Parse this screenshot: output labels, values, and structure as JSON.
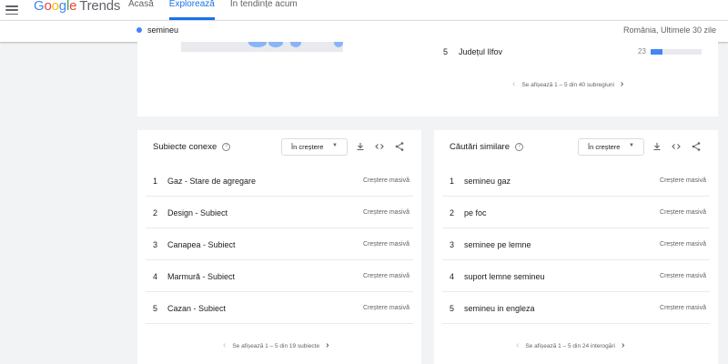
{
  "header": {
    "logo_letters": [
      "G",
      "o",
      "o",
      "g",
      "l",
      "e"
    ],
    "logo_product": "Trends",
    "nav": [
      {
        "label": "Acasă",
        "active": false
      },
      {
        "label": "Explorează",
        "active": true
      },
      {
        "label": "În tendințe acum",
        "active": false
      }
    ]
  },
  "search": {
    "term": "semineu",
    "term_color": "#4285f4",
    "region_time": "România, Ultimele 30 zile"
  },
  "subregions": {
    "visible_row": {
      "rank": "5",
      "name": "Județul Ilfov",
      "value": "23",
      "fraction": 0.23
    },
    "pager_text": "Se afișează 1 – 5 din 40 subregiuni"
  },
  "related_topics": {
    "title": "Subiecte conexe",
    "sort_label": "În creștere",
    "rows": [
      {
        "rank": "1",
        "label": "Gaz - Stare de agregare",
        "status": "Creștere masivă"
      },
      {
        "rank": "2",
        "label": "Design - Subiect",
        "status": "Creștere masivă"
      },
      {
        "rank": "3",
        "label": "Canapea - Subiect",
        "status": "Creștere masivă"
      },
      {
        "rank": "4",
        "label": "Marmură - Subiect",
        "status": "Creștere masivă"
      },
      {
        "rank": "5",
        "label": "Cazan - Subiect",
        "status": "Creștere masivă"
      }
    ],
    "pager_text": "Se afișează 1 – 5 din 19 subiecte"
  },
  "related_queries": {
    "title": "Căutări similare",
    "sort_label": "În creștere",
    "rows": [
      {
        "rank": "1",
        "label": "semineu gaz",
        "status": "Creștere masivă"
      },
      {
        "rank": "2",
        "label": "pe foc",
        "status": "Creștere masivă"
      },
      {
        "rank": "3",
        "label": "seminee pe lemne",
        "status": "Creștere masivă"
      },
      {
        "rank": "4",
        "label": "suport lemne semineu",
        "status": "Creștere masivă"
      },
      {
        "rank": "5",
        "label": "semineu in engleza",
        "status": "Creștere masivă"
      }
    ],
    "pager_text": "Se afișează 1 – 5 din 24 interogări"
  },
  "icons": {
    "menu": "hamburger-menu-icon",
    "help": "help-circle-icon",
    "download": "download-icon",
    "embed": "code-embed-icon",
    "share": "share-icon",
    "prev": "chevron-left-icon",
    "next": "chevron-right-icon"
  },
  "colors": {
    "accent": "#1a73e8",
    "bar": "#4285f4",
    "background": "#f1f3f4"
  }
}
